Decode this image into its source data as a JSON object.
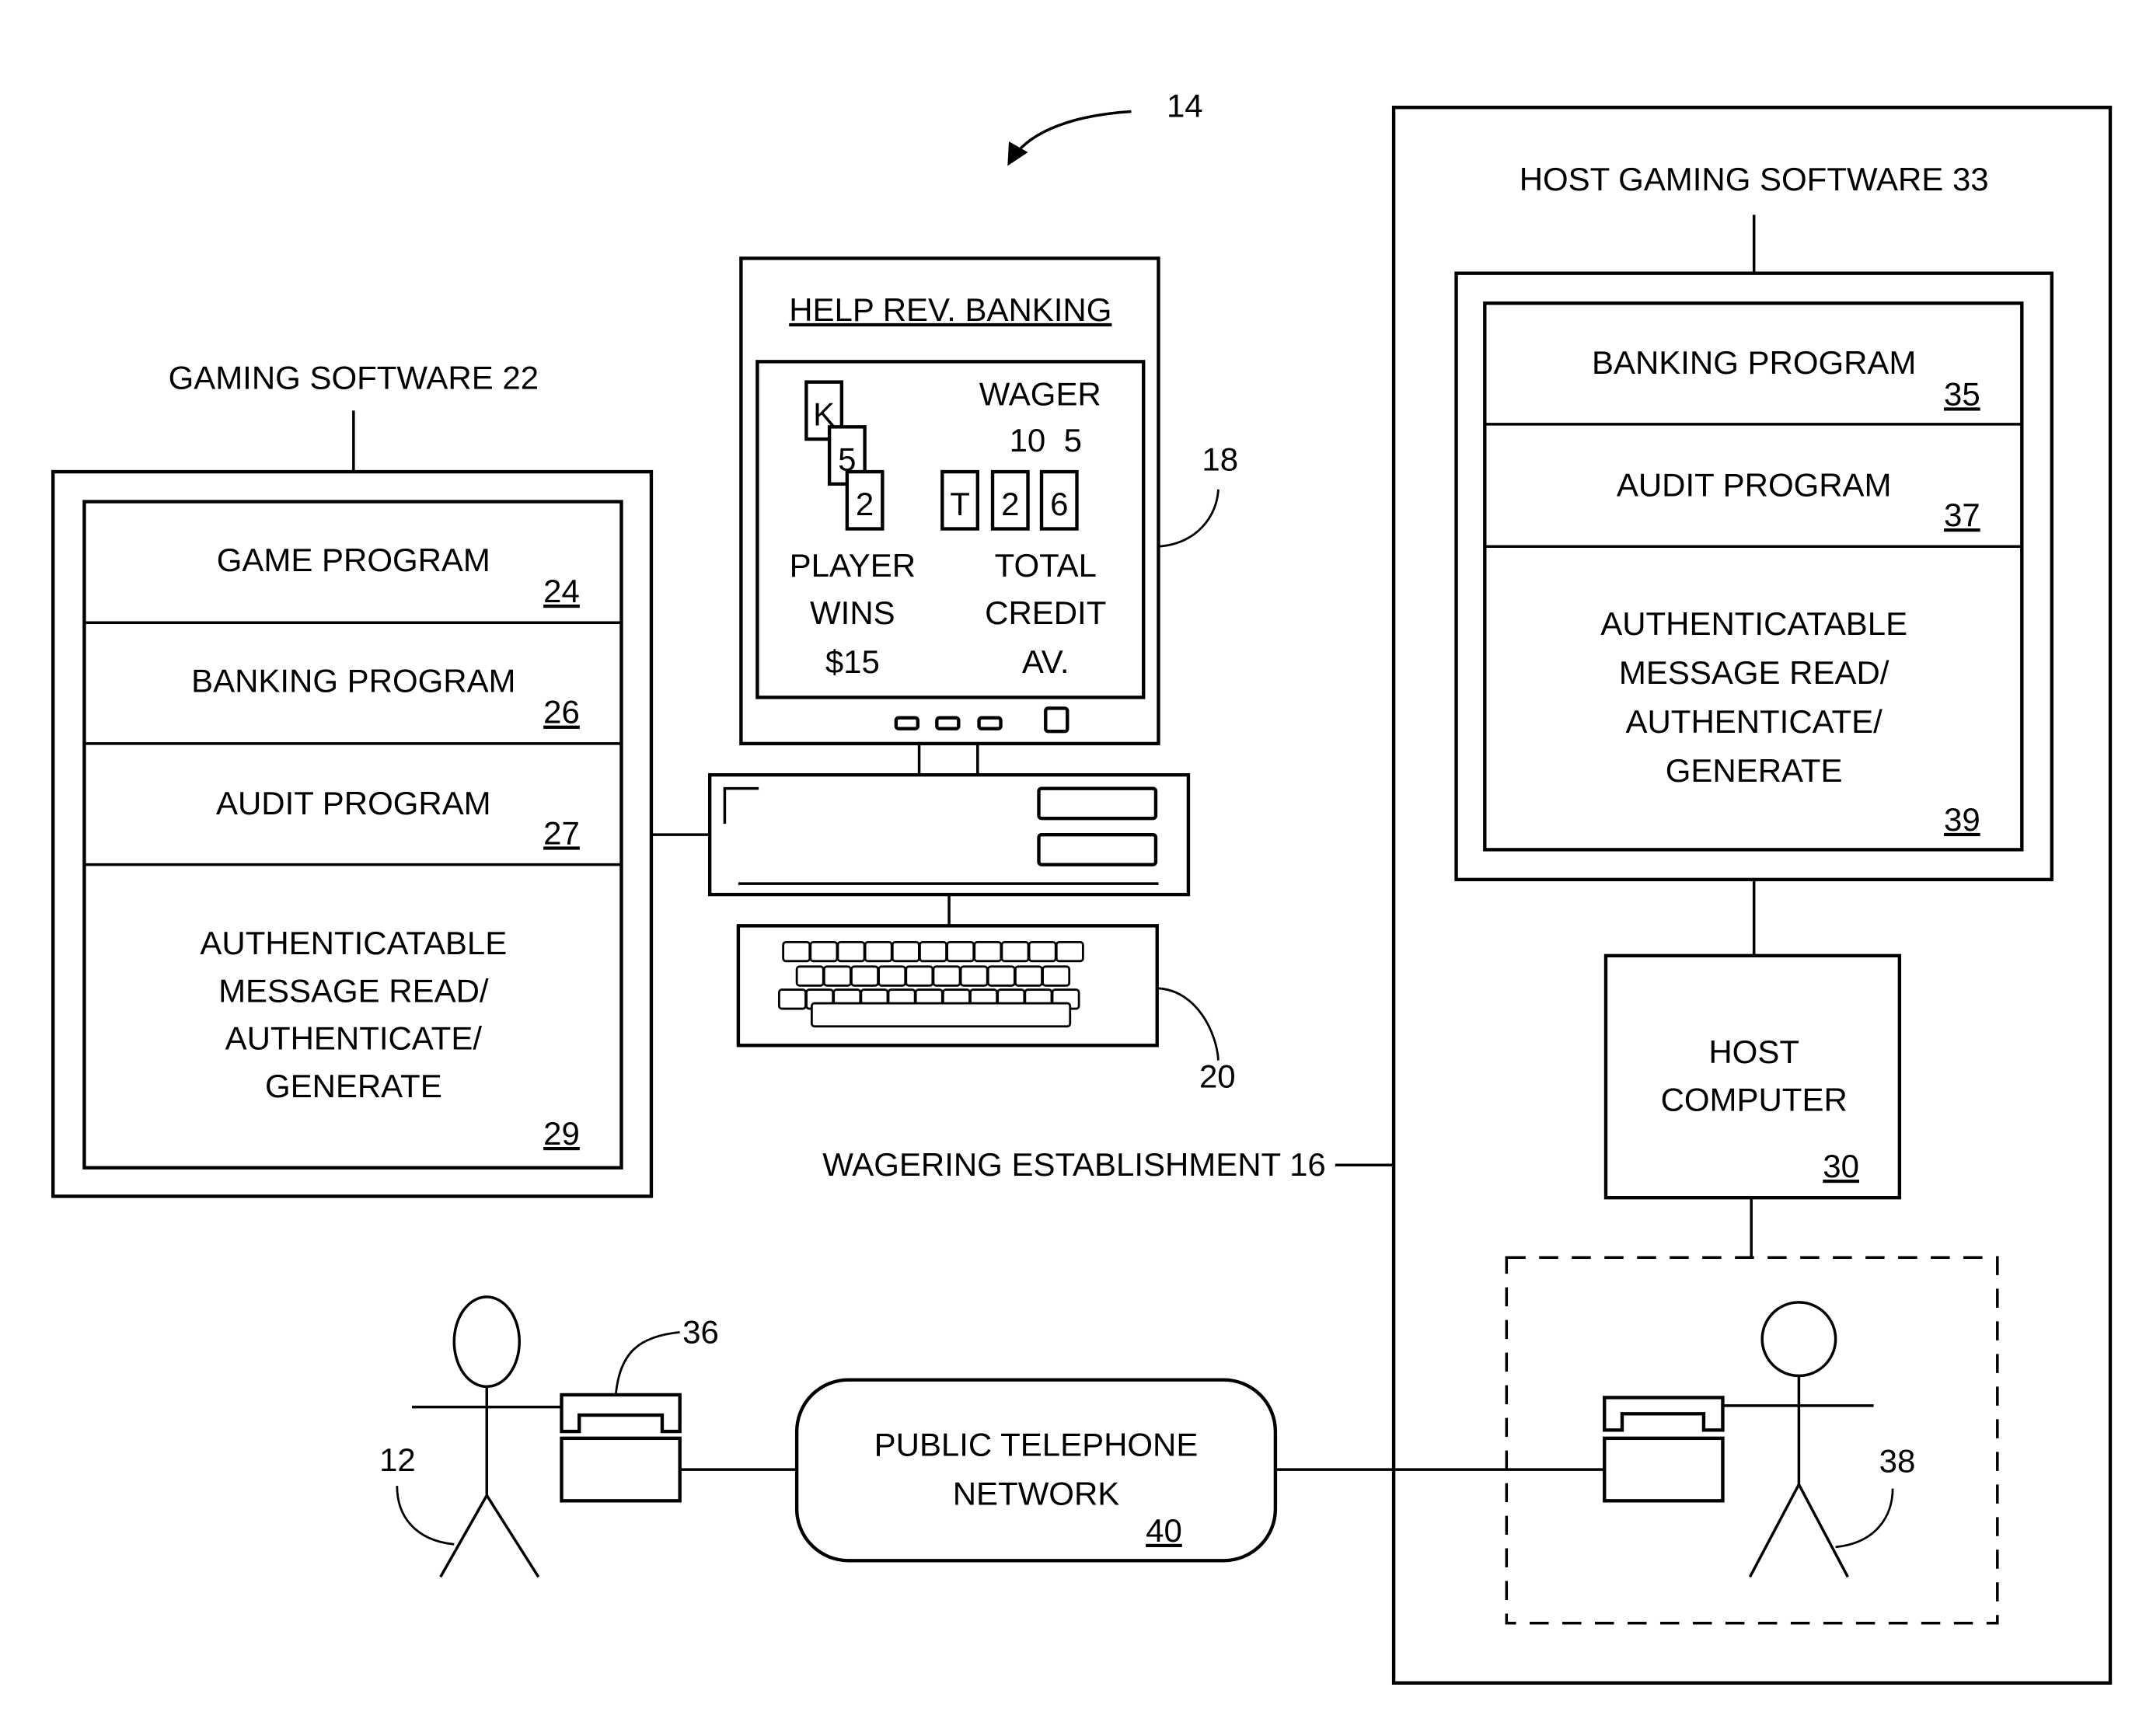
{
  "figure_ref": "14",
  "gaming_software": {
    "title": "GAMING SOFTWARE 22",
    "modules": [
      {
        "lines": [
          "GAME PROGRAM"
        ],
        "ref": "24"
      },
      {
        "lines": [
          "BANKING PROGRAM"
        ],
        "ref": "26"
      },
      {
        "lines": [
          "AUDIT PROGRAM"
        ],
        "ref": "27"
      },
      {
        "lines": [
          "AUTHENTICATABLE",
          "MESSAGE READ/",
          "AUTHENTICATE/",
          "GENERATE"
        ],
        "ref": "29"
      }
    ]
  },
  "terminal": {
    "ref": "18",
    "menu": "HELP REV. BANKING",
    "player_cards": [
      "K",
      "5",
      "2"
    ],
    "dealer_cards": [
      "T",
      "2",
      "6"
    ],
    "wager_label": "WAGER",
    "wager_values": "10  5",
    "player_wins": [
      "PLAYER",
      "WINS",
      "$15"
    ],
    "total_credit": [
      "TOTAL",
      "CREDIT",
      "AV."
    ],
    "keyboard_ref": "20"
  },
  "host": {
    "software_title": "HOST GAMING SOFTWARE 33",
    "modules": [
      {
        "lines": [
          "BANKING PROGRAM"
        ],
        "ref": "35"
      },
      {
        "lines": [
          "AUDIT PROGRAM"
        ],
        "ref": "37"
      },
      {
        "lines": [
          "AUTHENTICATABLE",
          "MESSAGE READ/",
          "AUTHENTICATE/",
          "GENERATE"
        ],
        "ref": "39"
      }
    ],
    "computer_lines": [
      "HOST",
      "COMPUTER"
    ],
    "computer_ref": "30",
    "establishment_label": "WAGERING ESTABLISHMENT 16",
    "operator_ref": "38"
  },
  "network": {
    "lines": [
      "PUBLIC TELEPHONE",
      "NETWORK"
    ],
    "ref": "40"
  },
  "player": {
    "ref": "12",
    "phone_ref": "36"
  }
}
